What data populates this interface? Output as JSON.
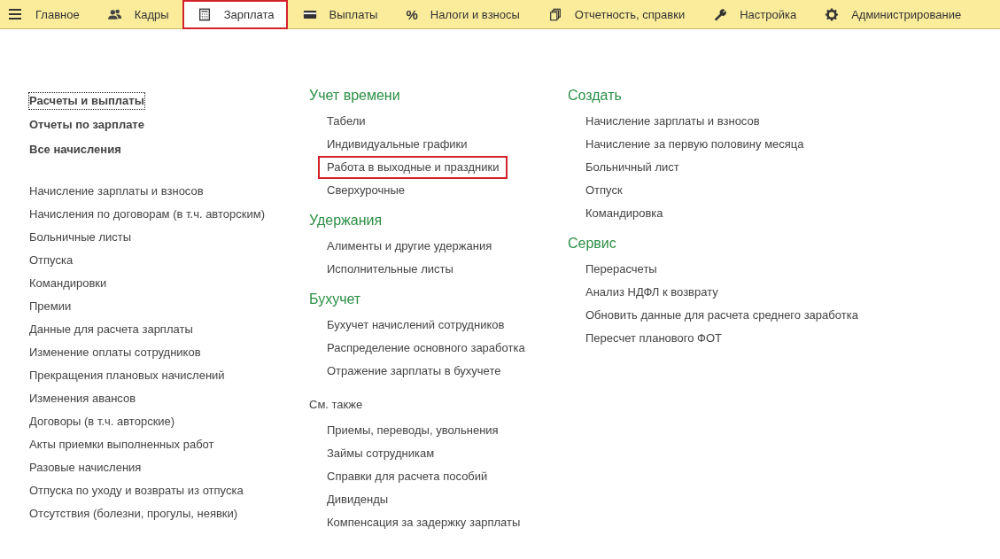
{
  "nav": [
    {
      "label": "Главное",
      "selected": false
    },
    {
      "label": "Кадры",
      "selected": false
    },
    {
      "label": "Зарплата",
      "selected": true
    },
    {
      "label": "Выплаты",
      "selected": false
    },
    {
      "label": "Налоги и взносы",
      "symbol": "%",
      "selected": false
    },
    {
      "label": "Отчетность, справки",
      "selected": false
    },
    {
      "label": "Настройка",
      "selected": false
    },
    {
      "label": "Администрирование",
      "selected": false
    }
  ],
  "left": {
    "main_links": [
      {
        "label": "Расчеты и выплаты",
        "focused": true
      },
      {
        "label": "Отчеты по зарплате",
        "focused": false
      },
      {
        "label": "Все начисления",
        "focused": false
      }
    ],
    "links": [
      "Начисление зарплаты и взносов",
      "Начисления по договорам (в т.ч. авторским)",
      "Больничные листы",
      "Отпуска",
      "Командировки",
      "Премии",
      "Данные для расчета зарплаты",
      "Изменение оплаты сотрудников",
      "Прекращения плановых начислений",
      "Изменения авансов",
      "Договоры (в т.ч. авторские)",
      "Акты приемки выполненных работ",
      "Разовые начисления",
      "Отпуска по уходу и возвраты из отпуска",
      "Отсутствия (болезни, прогулы, неявки)"
    ]
  },
  "columns": [
    {
      "sections": [
        {
          "title": "Учет времени",
          "kind": "heading",
          "items": [
            {
              "label": "Табели",
              "highlighted": false
            },
            {
              "label": "Индивидуальные графики",
              "highlighted": false
            },
            {
              "label": "Работа в выходные и праздники",
              "highlighted": true
            },
            {
              "label": "Сверхурочные",
              "highlighted": false
            }
          ]
        },
        {
          "title": "Удержания",
          "kind": "heading",
          "items": [
            {
              "label": "Алименты и другие удержания",
              "highlighted": false
            },
            {
              "label": "Исполнительные листы",
              "highlighted": false
            }
          ]
        },
        {
          "title": "Бухучет",
          "kind": "heading",
          "items": [
            {
              "label": "Бухучет начислений сотрудников",
              "highlighted": false
            },
            {
              "label": "Распределение основного заработка",
              "highlighted": false
            },
            {
              "label": "Отражение зарплаты в бухучете",
              "highlighted": false
            }
          ]
        },
        {
          "title": "См. также",
          "kind": "minor",
          "items": [
            {
              "label": "Приемы, переводы, увольнения",
              "highlighted": false
            },
            {
              "label": "Займы сотрудникам",
              "highlighted": false
            },
            {
              "label": "Справки для расчета пособий",
              "highlighted": false
            },
            {
              "label": "Дивиденды",
              "highlighted": false
            },
            {
              "label": "Компенсация за задержку зарплаты",
              "highlighted": false
            }
          ]
        }
      ]
    },
    {
      "sections": [
        {
          "title": "Создать",
          "kind": "heading",
          "items": [
            {
              "label": "Начисление зарплаты и взносов",
              "highlighted": false
            },
            {
              "label": "Начисление за первую половину месяца",
              "highlighted": false
            },
            {
              "label": "Больничный лист",
              "highlighted": false
            },
            {
              "label": "Отпуск",
              "highlighted": false
            },
            {
              "label": "Командировка",
              "highlighted": false
            }
          ]
        },
        {
          "title": "Сервис",
          "kind": "heading",
          "items": [
            {
              "label": "Перерасчеты",
              "highlighted": false
            },
            {
              "label": "Анализ НДФЛ к возврату",
              "highlighted": false
            },
            {
              "label": "Обновить данные для расчета среднего заработка",
              "highlighted": false
            },
            {
              "label": "Пересчет планового ФОТ",
              "highlighted": false
            }
          ]
        }
      ]
    }
  ]
}
